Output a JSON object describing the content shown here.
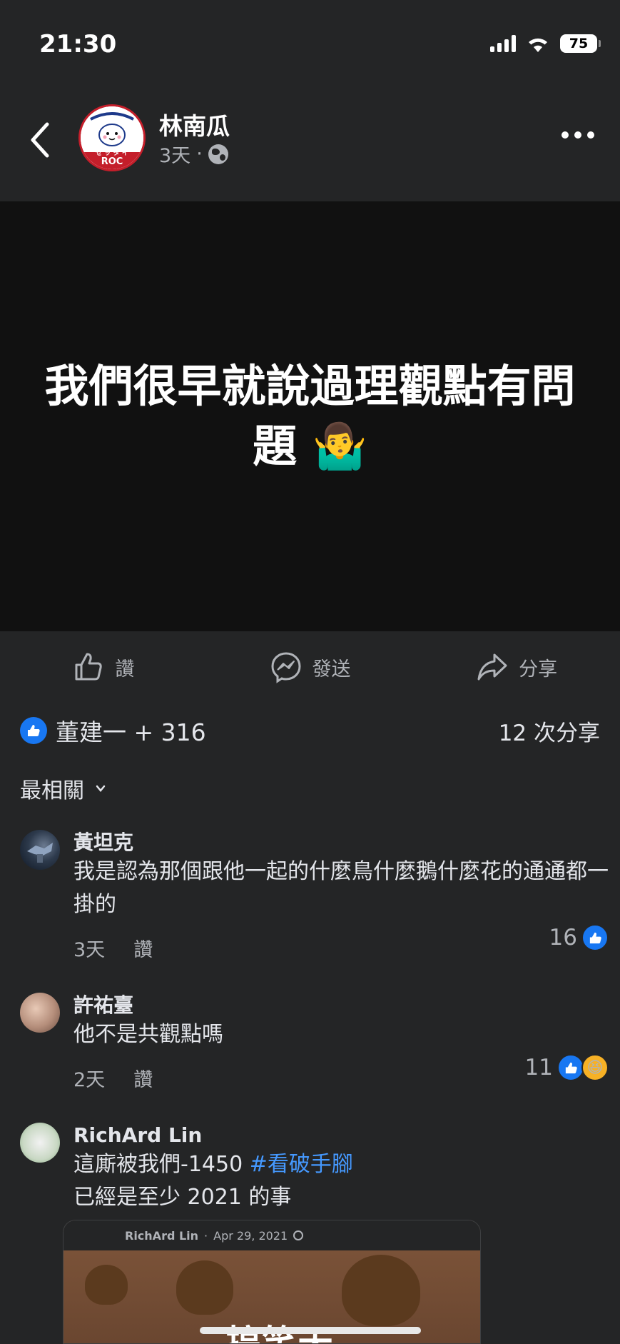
{
  "status_bar": {
    "time": "21:30",
    "battery": "75"
  },
  "post": {
    "author": "林南瓜",
    "time": "3天",
    "separator": "·",
    "image_text": "我們很早就說過理觀點有問題 🤷‍♂️",
    "avatar_text_top": "ぜ ッ タ イ",
    "avatar_text_bottom": "ROC"
  },
  "actions": {
    "like": "讚",
    "send": "發送",
    "share": "分享"
  },
  "summary": {
    "reactors": "董建一 + 316",
    "shares": "12 次分享"
  },
  "sort_label": "最相關",
  "comments": [
    {
      "name": "黃坦克",
      "text": "我是認為那個跟他一起的什麼鳥什麼鵝什麼花的通通都一掛的",
      "time": "3天",
      "like_label": "讚",
      "reaction_count": "16"
    },
    {
      "name": "許祐臺",
      "text": "他不是共觀點嗎",
      "time": "2天",
      "like_label": "讚",
      "reaction_count": "11"
    },
    {
      "name": "RichArd Lin",
      "text_prefix": "這廝被我們-1450 ",
      "hashtag": "#看破手腳",
      "text_line2": "已經是至少 2021 的事"
    }
  ],
  "shared_preview": {
    "author": "RichArd Lin",
    "date": "Apr 29, 2021",
    "caption": "搞笑天"
  },
  "colors": {
    "background": "#242526",
    "image_bg": "#111111",
    "accent_blue": "#1877f2",
    "hashtag": "#4599ff",
    "secondary_text": "#b0b3b8"
  }
}
